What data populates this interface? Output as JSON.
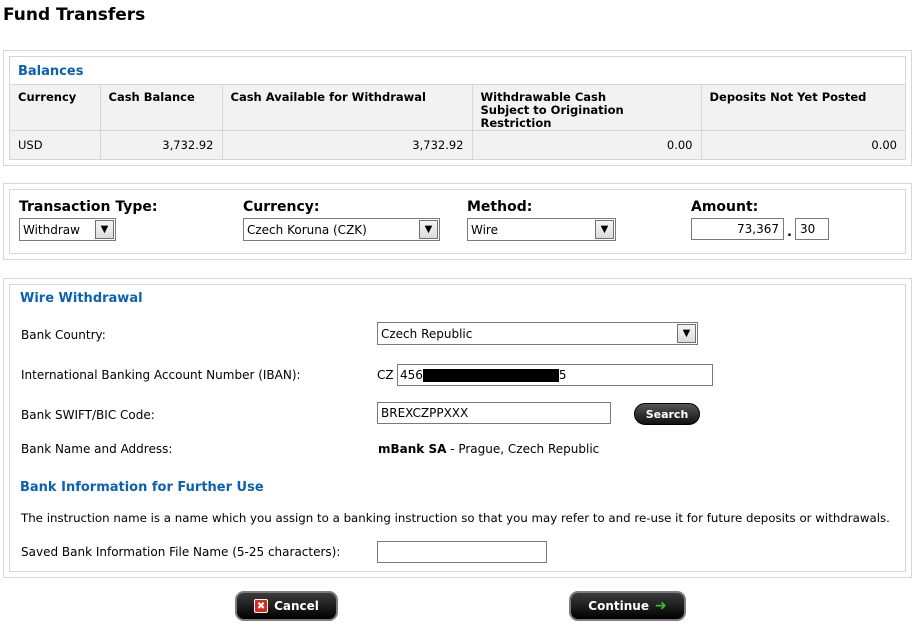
{
  "page": {
    "title": "Fund Transfers"
  },
  "balances": {
    "title": "Balances",
    "columns": [
      "Currency",
      "Cash Balance",
      "Cash Available for Withdrawal",
      "Withdrawable Cash Subject to Origination Restriction",
      "Deposits Not Yet Posted"
    ],
    "rows": [
      [
        "USD",
        "3,732.92",
        "3,732.92",
        "0.00",
        "0.00"
      ]
    ]
  },
  "transaction": {
    "type": {
      "label": "Transaction Type:",
      "value": "Withdraw"
    },
    "currency": {
      "label": "Currency:",
      "value": "Czech Koruna (CZK)"
    },
    "method": {
      "label": "Method:",
      "value": "Wire"
    },
    "amount": {
      "label": "Amount:",
      "whole": "73,367",
      "separator": ".",
      "cents": "30"
    }
  },
  "wire": {
    "title": "Wire Withdrawal",
    "bank_country": {
      "label": "Bank Country:",
      "value": "Czech Republic"
    },
    "iban": {
      "label": "International Banking Account Number (IBAN):",
      "prefix": "CZ",
      "start": "456",
      "end": "5"
    },
    "swift": {
      "label": "Bank SWIFT/BIC Code:",
      "value": "BREXCZPPXXX",
      "search_label": "Search"
    },
    "bank_name": {
      "label": "Bank Name and Address:",
      "name": "mBank SA",
      "address": " - Prague, Czech Republic"
    }
  },
  "further_use": {
    "title": "Bank Information for Further Use",
    "instruction": "The instruction name is a name which you assign to a banking instruction so that you may refer to and re-use it for future deposits or withdrawals.",
    "file_name": {
      "label": "Saved Bank Information File Name (5-25 characters):",
      "value": ""
    }
  },
  "buttons": {
    "cancel": "Cancel",
    "continue": "Continue"
  },
  "icons": {
    "cancel": "cancel-x-icon",
    "continue": "arrow-right-icon",
    "dropdown": "chevron-down-icon"
  },
  "colors": {
    "section_title": "#0b61b3",
    "cancel_icon": "#d9281f",
    "continue_arrow": "#35c12a"
  }
}
